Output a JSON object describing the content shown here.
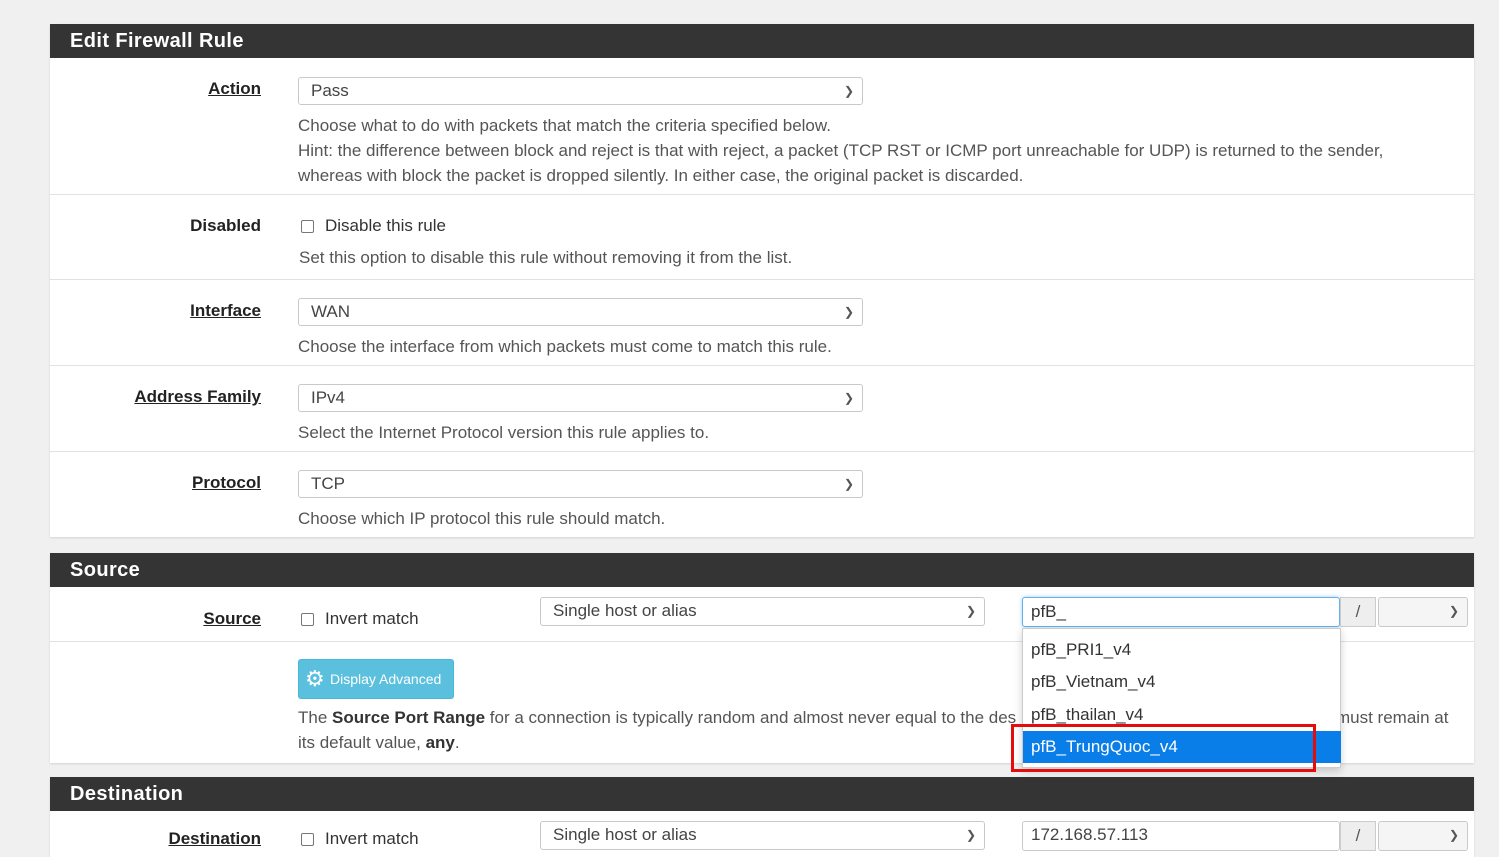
{
  "edit_panel": {
    "title": "Edit Firewall Rule",
    "action": {
      "label": "Action",
      "value": "Pass",
      "help1": "Choose what to do with packets that match the criteria specified below.",
      "help2": "Hint: the difference between block and reject is that with reject, a packet (TCP RST or ICMP port unreachable for UDP) is returned to the sender,",
      "help3": "whereas with block the packet is dropped silently. In either case, the original packet is discarded."
    },
    "disabled": {
      "label": "Disabled",
      "checkbox_label": "Disable this rule",
      "help": "Set this option to disable this rule without removing it from the list."
    },
    "interface": {
      "label": "Interface",
      "value": "WAN",
      "help": "Choose the interface from which packets must come to match this rule."
    },
    "address_family": {
      "label": "Address Family",
      "value": "IPv4",
      "help": "Select the Internet Protocol version this rule applies to."
    },
    "protocol": {
      "label": "Protocol",
      "value": "TCP",
      "help": "Choose which IP protocol this rule should match."
    }
  },
  "source_panel": {
    "title": "Source",
    "source_label": "Source",
    "invert_label": "Invert match",
    "type_value": "Single host or alias",
    "address_value": "pfB_",
    "slash": "/",
    "display_advanced": "Display Advanced",
    "help_pre": "The ",
    "help_bold": "Source Port Range",
    "help_mid": " for a connection is typically random and almost never equal to the des",
    "help_end": "must remain at",
    "help_line2_pre": "its default value, ",
    "help_line2_bold": "any",
    "help_line2_post": ".",
    "autocomplete": [
      "pfB_PRI1_v4",
      "pfB_Vietnam_v4",
      "pfB_thailan_v4",
      "pfB_TrungQuoc_v4"
    ]
  },
  "destination_panel": {
    "title": "Destination",
    "dest_label": "Destination",
    "invert_label": "Invert match",
    "type_value": "Single host or alias",
    "address_value": "172.168.57.113",
    "slash": "/"
  },
  "colors": {
    "header_bg": "#343434",
    "highlight": "#0a7ee8",
    "annotation": "#e30d0d",
    "button_info": "#5bc0de"
  }
}
